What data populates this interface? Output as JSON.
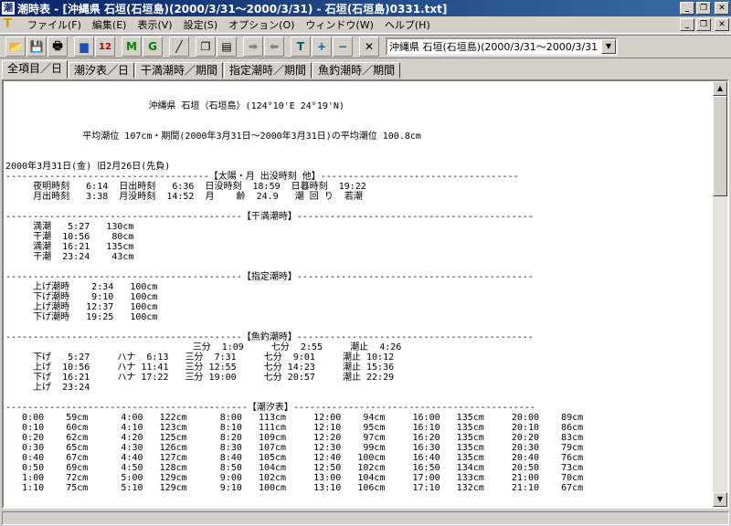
{
  "window": {
    "title": "潮時表 - [沖縄県 石垣(石垣島)(2000/3/31～2000/3/31) - 石垣(石垣島)0331.txt]",
    "icon_glyph": "潮"
  },
  "menu": {
    "items": [
      "ファイル(F)",
      "編集(E)",
      "表示(V)",
      "設定(S)",
      "オプション(O)",
      "ウィンドウ(W)",
      "ヘルプ(H)"
    ]
  },
  "toolbar": {
    "buttons": [
      {
        "name": "open",
        "glyph": "📂"
      },
      {
        "name": "save",
        "glyph": "💾"
      },
      {
        "name": "print",
        "glyph": "🖶"
      },
      {
        "name": "chart-blue",
        "glyph": "▆"
      },
      {
        "name": "12",
        "glyph": "12"
      },
      {
        "name": "m",
        "glyph": "M"
      },
      {
        "name": "g",
        "glyph": "G"
      },
      {
        "name": "graph",
        "glyph": "╱"
      },
      {
        "name": "copy",
        "glyph": "❐"
      },
      {
        "name": "paste",
        "glyph": "▤"
      },
      {
        "name": "next",
        "glyph": "➡"
      },
      {
        "name": "prev",
        "glyph": "⬅"
      },
      {
        "name": "text",
        "glyph": "T"
      },
      {
        "name": "plus",
        "glyph": "+"
      },
      {
        "name": "minus",
        "glyph": "−"
      },
      {
        "name": "close",
        "glyph": "✕"
      }
    ],
    "location_select": "沖縄県 石垣(石垣島)(2000/3/31～2000/3/31"
  },
  "tabs": [
    "全項目／日",
    "潮汐表／日",
    "干満潮時／期間",
    "指定潮時／期間",
    "魚釣潮時／期間"
  ],
  "document": {
    "lines": [
      "",
      "",
      "                          沖縄県 石垣（石垣島）(124°10'E 24°19'N)",
      "",
      "",
      "              平均潮位 107cm・期間(2000年3月31日～2000年3月31日)の平均潮位 100.8cm",
      "",
      "",
      "2000年3月31日(金) 旧2月26日(先負)",
      "-------------------------------------【太陽・月 出没時刻 他】------------------------------------",
      "     夜明時刻   6:14  日出時刻   6:36  日没時刻  18:59  日暮時刻  19:22",
      "     月出時刻   3:38  月没時刻  14:52  月    齢  24.9   潮 回 り  若潮",
      "",
      "-------------------------------------------【干満潮時】-------------------------------------------",
      "     満潮   5:27   130cm",
      "     干潮  10:56    80cm",
      "     満潮  16:21   135cm",
      "     干潮  23:24    43cm",
      "",
      "-------------------------------------------【指定潮時】-------------------------------------------",
      "     上げ潮時    2:34   100cm",
      "     下げ潮時    9:10   100cm",
      "     上げ潮時   12:37   100cm",
      "     下げ潮時   19:25   100cm",
      "",
      "-------------------------------------------【魚釣潮時】-------------------------------------------",
      "                                  三分  1:09     七分  2:55     潮止  4:26",
      "     下げ   5:27     ハナ  6:13   三分  7:31     七分  9:01     潮止 10:12",
      "     上げ  10:56     ハナ 11:41   三分 12:55     七分 14:23     潮止 15:36",
      "     下げ  16:21     ハナ 17:22   三分 19:00     七分 20:57     潮止 22:29",
      "     上げ  23:24",
      "",
      "--------------------------------------------【潮汐表】--------------------------------------------",
      "   0:00    59cm      4:00   122cm      8:00   113cm     12:00    94cm     16:00   135cm     20:00    89cm",
      "   0:10    60cm      4:10   123cm      8:10   111cm     12:10    95cm     16:10   135cm     20:10    86cm",
      "   0:20    62cm      4:20   125cm      8:20   109cm     12:20    97cm     16:20   135cm     20:20    83cm",
      "   0:30    65cm      4:30   126cm      8:30   107cm     12:30    99cm     16:30   135cm     20:30    79cm",
      "   0:40    67cm      4:40   127cm      8:40   105cm     12:40   100cm     16:40   135cm     20:40    76cm",
      "   0:50    69cm      4:50   128cm      8:50   104cm     12:50   102cm     16:50   134cm     20:50    73cm",
      "   1:00    72cm      5:00   129cm      9:00   102cm     13:00   104cm     17:00   133cm     21:00    70cm",
      "   1:10    75cm      5:10   129cm      9:10   100cm     13:10   106cm     17:10   132cm     21:10    67cm"
    ]
  },
  "status": {
    "text": ""
  }
}
